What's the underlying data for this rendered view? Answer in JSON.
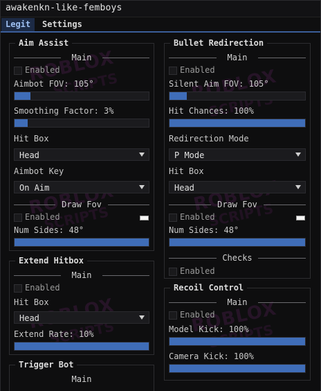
{
  "window": {
    "title": "awakenkn-like-femboys"
  },
  "tabs": [
    {
      "label": "Legit",
      "active": true
    },
    {
      "label": "Settings",
      "active": false
    }
  ],
  "colors": {
    "accent": "#3f6db8",
    "tab_active_bg": "#1c2a45",
    "background": "#0e0e0f"
  },
  "watermark": {
    "line1": "ROBLOX",
    "line2": "SCRIPTS",
    "line3": ".com"
  },
  "aim_assist": {
    "title": "Aim Assist",
    "main_header": "Main",
    "enabled_label": "Enabled",
    "enabled": false,
    "fov_label": "Aimbot FOV: 105°",
    "fov_value": 105,
    "fov_fill": 0.12,
    "smoothing_label": "Smoothing Factor: 3%",
    "smoothing_value": 3,
    "smoothing_fill": 0.1,
    "hitbox_label": "Hit Box",
    "hitbox_value": "Head",
    "key_label": "Aimbot Key",
    "key_value": "On Aim",
    "draw_fov_header": "Draw Fov",
    "draw_enabled_label": "Enabled",
    "draw_enabled": false,
    "draw_color": "#f4f4f4",
    "num_sides_label": "Num Sides: 48°",
    "num_sides_value": 48,
    "num_sides_fill": 1.0
  },
  "extend_hitbox": {
    "title": "Extend Hitbox",
    "main_header": "Main",
    "enabled_label": "Enabled",
    "enabled": false,
    "hitbox_label": "Hit Box",
    "hitbox_value": "Head",
    "rate_label": "Extend Rate: 10%",
    "rate_value": 10,
    "rate_fill": 1.0
  },
  "trigger_bot": {
    "title": "Trigger Bot",
    "main_header": "Main"
  },
  "bullet_redirection": {
    "title": "Bullet Redirection",
    "main_header": "Main",
    "enabled_label": "Enabled",
    "enabled": false,
    "fov_label": "Silent Aim FOV: 105°",
    "fov_value": 105,
    "fov_fill": 0.13,
    "chances_label": "Hit Chances: 100%",
    "chances_value": 100,
    "chances_fill": 1.0,
    "mode_label": "Redirection Mode",
    "mode_value": "P Mode",
    "hitbox_label": "Hit Box",
    "hitbox_value": "Head",
    "draw_fov_header": "Draw Fov",
    "draw_enabled_label": "Enabled",
    "draw_enabled": false,
    "draw_color": "#f4f4f4",
    "num_sides_label": "Num Sides: 48°",
    "num_sides_value": 48,
    "num_sides_fill": 1.0,
    "checks_header": "Checks",
    "checks_enabled_label": "Enabled",
    "checks_enabled": false
  },
  "recoil_control": {
    "title": "Recoil Control",
    "main_header": "Main",
    "enabled_label": "Enabled",
    "enabled": false,
    "model_kick_label": "Model Kick: 100%",
    "model_kick_value": 100,
    "model_kick_fill": 1.0,
    "camera_kick_label": "Camera Kick: 100%",
    "camera_kick_value": 100,
    "camera_kick_fill": 1.0
  }
}
